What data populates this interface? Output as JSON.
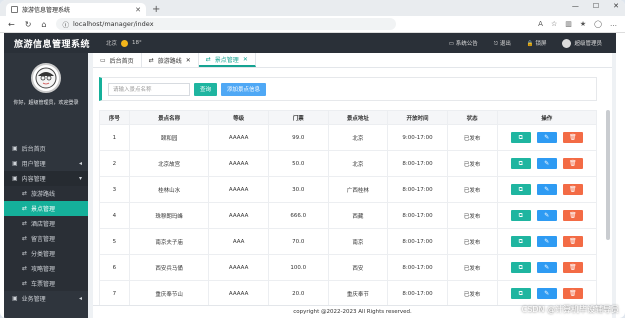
{
  "browser": {
    "tab_title": "旅游信息管理系统",
    "url": "localhost/manager/index"
  },
  "header": {
    "brand": "旅游信息管理系统",
    "weather_city": "北京",
    "weather_temp": "18°",
    "notice": "系统公告",
    "logout": "退出",
    "lock": "锁屏",
    "user": "超级管理员"
  },
  "sidebar": {
    "greeting": "你好，超级管理员，欢迎登录",
    "items": [
      {
        "label": "后台首页",
        "sub": false,
        "active": false
      },
      {
        "label": "用户管理",
        "sub": false,
        "active": false,
        "arrow": "◂"
      },
      {
        "label": "内容管理",
        "sub": false,
        "active": false,
        "arrow": "▾",
        "open": true
      },
      {
        "label": "旅游路线",
        "sub": true,
        "active": false
      },
      {
        "label": "景点管理",
        "sub": true,
        "active": true
      },
      {
        "label": "酒店管理",
        "sub": true,
        "active": false
      },
      {
        "label": "留言管理",
        "sub": true,
        "active": false
      },
      {
        "label": "分类管理",
        "sub": true,
        "active": false
      },
      {
        "label": "攻略管理",
        "sub": true,
        "active": false
      },
      {
        "label": "车票管理",
        "sub": true,
        "active": false
      },
      {
        "label": "业务管理",
        "sub": false,
        "active": false,
        "arrow": "◂"
      }
    ]
  },
  "content_tabs": [
    {
      "label": "后台首页",
      "current": false,
      "close": false
    },
    {
      "label": "旅游路线",
      "current": false,
      "close": true
    },
    {
      "label": "景点管理",
      "current": true,
      "close": true
    }
  ],
  "toolbar": {
    "search_placeholder": "请输入景点名称",
    "query_label": "查询",
    "add_label": "添加景点信息"
  },
  "table": {
    "headers": [
      "序号",
      "景点名称",
      "等级",
      "门票",
      "景点地址",
      "开放时间",
      "状态",
      "操作"
    ],
    "rows": [
      [
        "1",
        "颐和园",
        "AAAAA",
        "99.0",
        "北京",
        "9:00-17:00",
        "已发布"
      ],
      [
        "2",
        "北京故宫",
        "AAAAA",
        "50.0",
        "北京",
        "8:00-17:00",
        "已发布"
      ],
      [
        "3",
        "桂林山水",
        "AAAAA",
        "30.0",
        "广西桂林",
        "8:00-17:00",
        "已发布"
      ],
      [
        "4",
        "珠穆朗玛峰",
        "AAAAA",
        "666.0",
        "西藏",
        "8:00-17:00",
        "已发布"
      ],
      [
        "5",
        "南京夫子庙",
        "AAA",
        "70.0",
        "南京",
        "8:00-17:00",
        "已发布"
      ],
      [
        "6",
        "西安兵马俑",
        "AAAAA",
        "100.0",
        "西安",
        "8:00-17:00",
        "已发布"
      ],
      [
        "7",
        "重庆奉节山",
        "AAAAA",
        "20.0",
        "重庆奉节",
        "8:00-17:00",
        "已发布"
      ]
    ]
  },
  "footer": "copyright @2022-2023 All Rights reserved.",
  "watermark": "CSDN @计算机毕设辅导员"
}
